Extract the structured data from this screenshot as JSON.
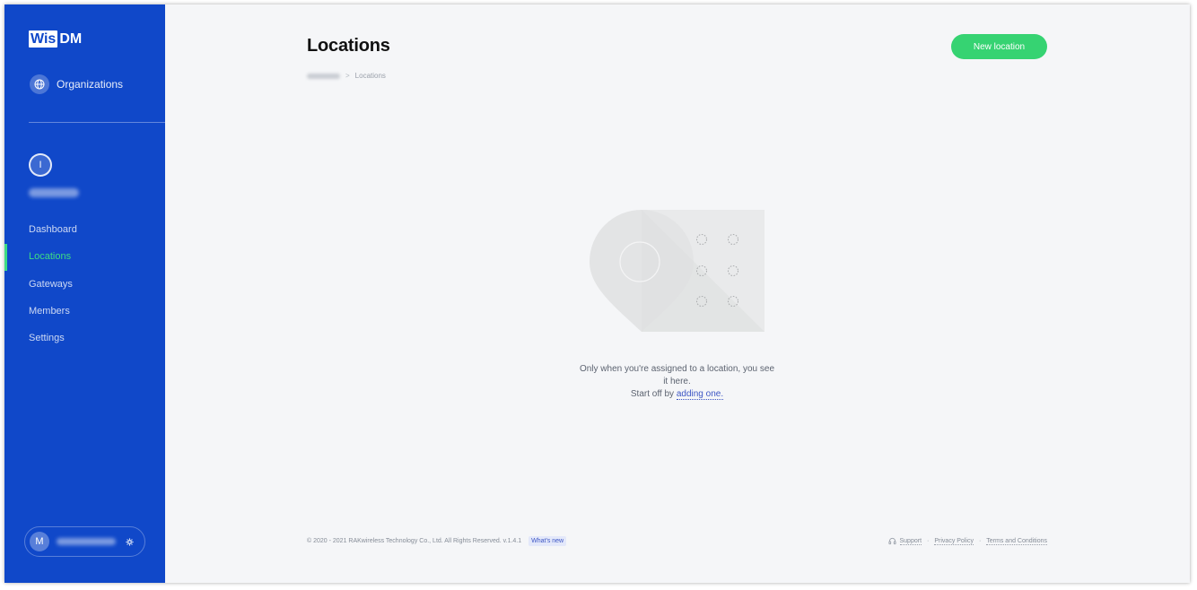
{
  "sidebar": {
    "logo": {
      "part1": "Wis",
      "part2": "DM"
    },
    "organizations_label": "Organizations",
    "org_avatar_initial": "I",
    "nav": [
      {
        "label": "Dashboard",
        "active": false
      },
      {
        "label": "Locations",
        "active": true
      },
      {
        "label": "Gateways",
        "active": false
      },
      {
        "label": "Members",
        "active": false
      },
      {
        "label": "Settings",
        "active": false
      }
    ],
    "user_initial": "M"
  },
  "header": {
    "title": "Locations",
    "new_button": "New location",
    "breadcrumb_current": "Locations",
    "breadcrumb_separator": ">"
  },
  "empty_state": {
    "line1": "Only when you're assigned to a location, you see it here.",
    "line2_prefix": "Start off by",
    "line2_link": "adding one."
  },
  "footer": {
    "copyright": "© 2020 - 2021 RAKwireless Technology Co., Ltd. All Rights Reserved. v.1.4.1",
    "whats_new": "What's new",
    "support": "Support",
    "privacy": "Privacy Policy",
    "terms": "Terms and Conditions",
    "separator": "·"
  },
  "colors": {
    "sidebar_bg": "#1048c9",
    "accent_green": "#36d372",
    "active_nav": "#3ddc84",
    "page_bg": "#f5f6f8",
    "link": "#3d56c4"
  }
}
